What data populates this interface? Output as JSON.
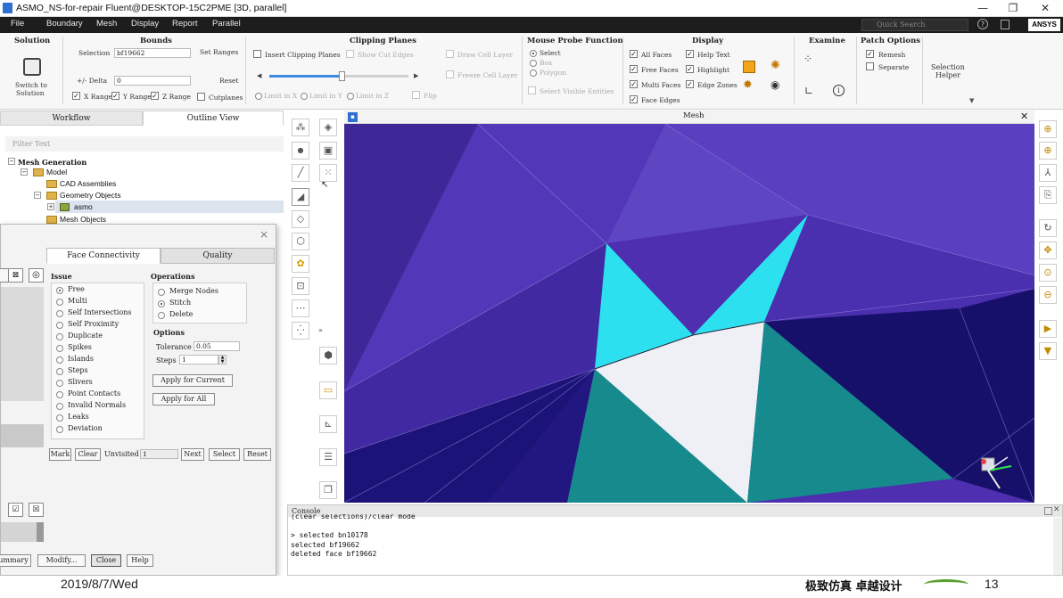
{
  "window": {
    "title": "ASMO_NS-for-repair Fluent@DESKTOP-15C2PME  [3D, parallel]",
    "minimize": "—",
    "maximize": "❐",
    "close": "✕"
  },
  "menu": {
    "items": [
      "File",
      "Boundary",
      "Mesh",
      "Display",
      "Report",
      "Parallel"
    ],
    "search_placeholder": "Quick Search",
    "help": "?",
    "brand": "ANSYS"
  },
  "ribbon": {
    "solution": {
      "title": "Solution",
      "switch_label_1": "Switch to",
      "switch_label_2": "Solution"
    },
    "bounds": {
      "title": "Bounds",
      "selection_label": "Selection",
      "selection_value": "bf19662",
      "set_ranges": "Set Ranges",
      "delta_label": "+/- Delta",
      "delta_value": "0",
      "reset": "Reset",
      "x_range": "X Range",
      "y_range": "Y Range",
      "z_range": "Z Range",
      "cutplanes": "Cutplanes"
    },
    "clipping": {
      "title": "Clipping Planes",
      "insert": "Insert Clipping Planes",
      "show_cut_edges": "Show Cut Edges",
      "draw_cell_layer": "Draw Cell Layer",
      "freeze_cell_layer": "Freeze Cell Layer",
      "limit_x": "Limit in X",
      "limit_y": "Limit in Y",
      "limit_z": "Limit in Z",
      "flip": "Flip",
      "slider_value": 0.52
    },
    "mouse_probe": {
      "title": "Mouse Probe Function",
      "select": "Select",
      "box": "Box",
      "polygon": "Polygon",
      "select_visible": "Select Visible Entities"
    },
    "display": {
      "title": "Display",
      "all_faces": "All Faces",
      "free_faces": "Free Faces",
      "multi_faces": "Multi Faces",
      "face_edges": "Face Edges",
      "help_text": "Help Text",
      "highlight": "Highlight",
      "edge_zones": "Edge Zones"
    },
    "examine": {
      "title": "Examine"
    },
    "patch": {
      "title": "Patch Options",
      "remesh": "Remesh",
      "separate": "Separate"
    },
    "selection_helper": {
      "line1": "Selection",
      "line2": "Helper"
    }
  },
  "left_panel": {
    "tabs": [
      "Workflow",
      "Outline View"
    ],
    "filter_placeholder": "Filter Text",
    "tree": {
      "root": "Mesh Generation",
      "model": "Model",
      "cad": "CAD Assemblies",
      "geometry": "Geometry Objects",
      "asmo": "asmo",
      "mesh_objects": "Mesh Objects"
    }
  },
  "dialog": {
    "close": "×",
    "tabs": [
      "Face Connectivity",
      "Quality"
    ],
    "issue_title": "Issue",
    "issues": [
      "Free",
      "Multi",
      "Self Intersections",
      "Self Proximity",
      "Duplicate",
      "Spikes",
      "Islands",
      "Steps",
      "Slivers",
      "Point Contacts",
      "Invalid Normals",
      "Leaks",
      "Deviation"
    ],
    "selected_issue": "Free",
    "operations_title": "Operations",
    "operations": [
      "Merge Nodes",
      "Stitch",
      "Delete"
    ],
    "selected_operation": "Stitch",
    "options_title": "Options",
    "tolerance_label": "Tolerance",
    "tolerance_value": "0.05",
    "steps_label": "Steps",
    "steps_value": "1",
    "apply_current": "Apply for Current",
    "apply_all": "Apply for All",
    "mark": "Mark",
    "clear": "Clear",
    "unvisited_label": "Unvisited",
    "unvisited_value": "1",
    "next": "Next",
    "select": "Select",
    "reset": "Reset",
    "summary": "ummary",
    "modify": "Modify...",
    "close_btn": "Close",
    "help": "Help"
  },
  "graphics": {
    "title": "Mesh",
    "close": "✕"
  },
  "console": {
    "title": "Console",
    "lines": [
      "(clear selections)/clear mode",
      "",
      "> selected bn10178",
      "selected bf19662",
      "deleted face bf19662"
    ]
  },
  "footer": {
    "date": "2019/8/7/Wed",
    "slogan": "极致仿真  卓越设计",
    "page": "13"
  },
  "colors": {
    "mesh_background": "#4d2fb0",
    "cyan_face": "#2de0f0",
    "white_face": "#eef0f6",
    "teal_face": "#178a8e",
    "navy_face": "#17106a"
  }
}
